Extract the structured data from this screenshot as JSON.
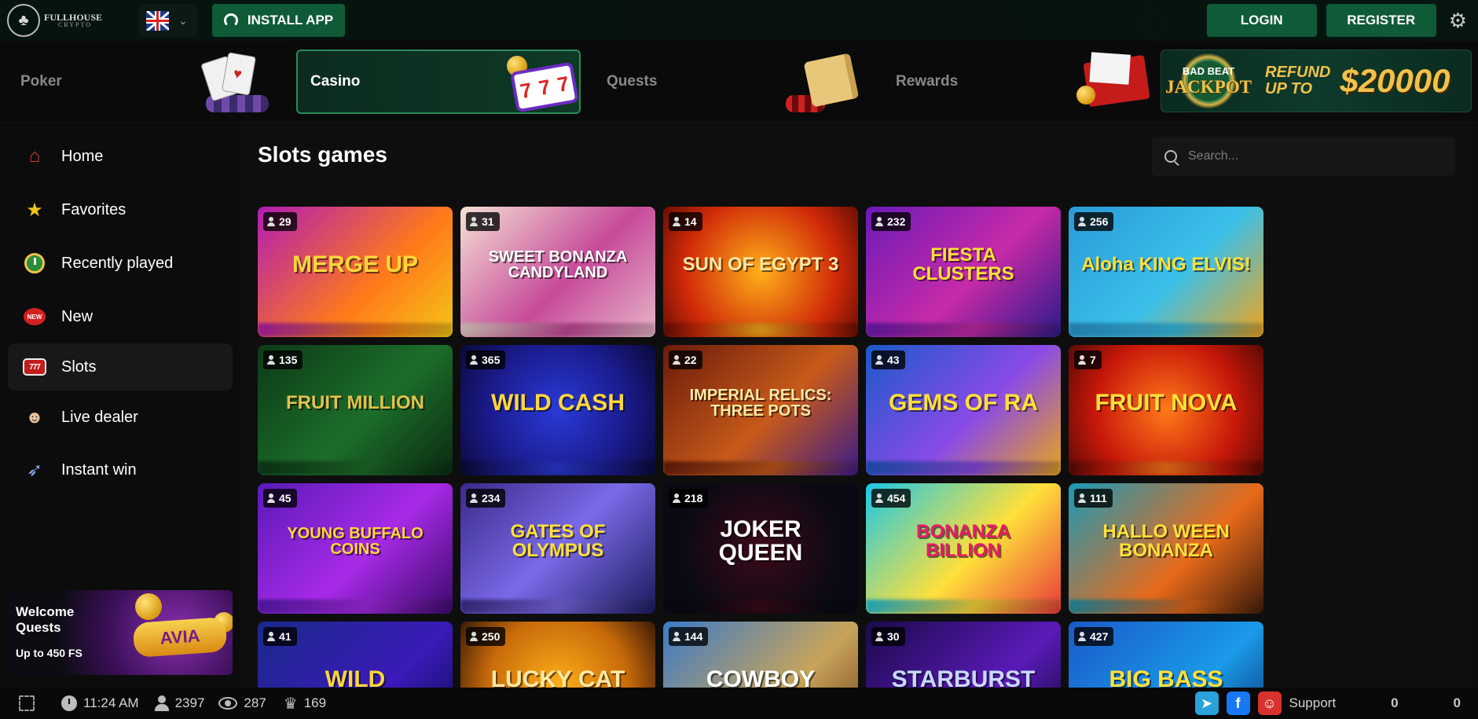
{
  "header": {
    "logo_line1": "FULLHOUSE",
    "logo_line2": "CRYPTO",
    "install_label": "INSTALL APP",
    "login_label": "LOGIN",
    "register_label": "REGISTER",
    "language": "flag-uk-icon"
  },
  "categories": [
    {
      "label": "Poker",
      "active": false
    },
    {
      "label": "Casino",
      "active": true
    },
    {
      "label": "Quests",
      "active": false
    },
    {
      "label": "Rewards",
      "active": false
    }
  ],
  "jackpot": {
    "badge_top": "BAD BEAT",
    "badge_main": "JACKPOT",
    "refund_line1": "REFUND",
    "refund_line2": "UP TO",
    "amount": "$20000"
  },
  "sidebar": {
    "items": [
      {
        "label": "Home",
        "icon": "home-icon"
      },
      {
        "label": "Favorites",
        "icon": "star-icon"
      },
      {
        "label": "Recently played",
        "icon": "clock-icon"
      },
      {
        "label": "New",
        "icon": "new-badge-icon",
        "icon_text": "NEW"
      },
      {
        "label": "Slots",
        "icon": "slot-machine-icon",
        "icon_text": "777",
        "active": true
      },
      {
        "label": "Live dealer",
        "icon": "dealer-icon"
      },
      {
        "label": "Instant win",
        "icon": "rocket-icon"
      }
    ],
    "promo": {
      "line1": "Welcome",
      "line2": "Quests",
      "sub": "Up to 450 FS",
      "game_logo": "AVIA MASTERS"
    }
  },
  "main": {
    "title": "Slots games",
    "search_placeholder": "Search..."
  },
  "games": [
    {
      "name": "MERGE UP",
      "players": "29",
      "bg": "linear-gradient(135deg,#b01cb4,#ff7a1a 60%,#f5c518)",
      "fg": "#ffd63a"
    },
    {
      "name": "SWEET BONANZA CANDYLAND",
      "players": "31",
      "bg": "linear-gradient(135deg,#f4e2d4,#c74a9a 55%,#e6b6c8)",
      "fg": "#ffffff"
    },
    {
      "name": "SUN OF EGYPT 3",
      "players": "14",
      "bg": "radial-gradient(circle,#ffb01a,#d02a08 65%,#6a0d05)",
      "fg": "#ffe9a3"
    },
    {
      "name": "FIESTA CLUSTERS",
      "players": "232",
      "bg": "linear-gradient(135deg,#6b1ab8,#c72aa8 55%,#2a1a8a)",
      "fg": "#ffe03a"
    },
    {
      "name": "Aloha KING ELVIS!",
      "players": "256",
      "bg": "linear-gradient(135deg,#2a9ad8,#3ac0e8 55%,#f2a41a)",
      "fg": "#ffe03a"
    },
    {
      "name": "FRUIT MILLION",
      "players": "135",
      "bg": "linear-gradient(135deg,#0c3a18,#1d6e2a 55%,#0a2a12)",
      "fg": "#e0c24a"
    },
    {
      "name": "WILD CASH",
      "players": "365",
      "bg": "radial-gradient(circle,#2a3ad8,#1a1a8a 60%,#0a0a3a)",
      "fg": "#ffd63a"
    },
    {
      "name": "IMPERIAL RELICS: THREE POTS",
      "players": "22",
      "bg": "linear-gradient(135deg,#6a1a0a,#c75a1a 55%,#3a1a8a)",
      "fg": "#ffe9a3"
    },
    {
      "name": "GEMS OF RA",
      "players": "43",
      "bg": "linear-gradient(135deg,#1a5ac8,#8a4ae8 55%,#e8a41a)",
      "fg": "#ffe03a"
    },
    {
      "name": "FRUIT NOVA",
      "players": "7",
      "bg": "radial-gradient(circle,#ff7a1a,#c8180a 60%,#5a0a05)",
      "fg": "#ffe03a"
    },
    {
      "name": "YOUNG BUFFALO COINS",
      "players": "45",
      "bg": "linear-gradient(135deg,#5a1ab8,#a82ae8 55%,#3a0a6a)",
      "fg": "#ffd63a"
    },
    {
      "name": "GATES OF OLYMPUS",
      "players": "234",
      "bg": "linear-gradient(135deg,#3a2a8a,#7a6ae8 50%,#1a1a5a)",
      "fg": "#ffe03a"
    },
    {
      "name": "JOKER QUEEN",
      "players": "218",
      "bg": "radial-gradient(circle,#3a0a1a,#0a0a14 70%)",
      "fg": "#ffffff"
    },
    {
      "name": "BONANZA BILLION",
      "players": "454",
      "bg": "linear-gradient(135deg,#1ac8e8,#ffe03a 55%,#e83a3a)",
      "fg": "#e81a6a"
    },
    {
      "name": "HALLO WEEN BONANZA",
      "players": "111",
      "bg": "linear-gradient(135deg,#1a9ab8,#e86a1a 60%,#3a1a0a)",
      "fg": "#ffe03a"
    },
    {
      "name": "WILD",
      "players": "41",
      "bg": "linear-gradient(135deg,#1a2a8a,#3a1ab8 60%,#0a0a4a)",
      "fg": "#ffd63a"
    },
    {
      "name": "LUCKY CAT",
      "players": "250",
      "bg": "radial-gradient(circle,#ffb01a,#c86a0a 60%,#3a1a05)",
      "fg": "#ffe9a3"
    },
    {
      "name": "COWBOY",
      "players": "144",
      "bg": "linear-gradient(135deg,#3a7ac8,#c8a45a 60%,#6a3a1a)",
      "fg": "#ffffff"
    },
    {
      "name": "STARBURST",
      "players": "30",
      "bg": "linear-gradient(135deg,#1a0a4a,#5a1ab8 60%,#0a0a2a)",
      "fg": "#c8d8ff"
    },
    {
      "name": "BIG BASS",
      "players": "427",
      "bg": "linear-gradient(135deg,#1a5ac8,#1a9ae8 60%,#0a2a6a)",
      "fg": "#ffe03a"
    }
  ],
  "footer": {
    "time": "11:24 AM",
    "online": "2397",
    "watching": "287",
    "trophies": "169",
    "support_label": "Support",
    "value1": "0",
    "value2": "0"
  }
}
